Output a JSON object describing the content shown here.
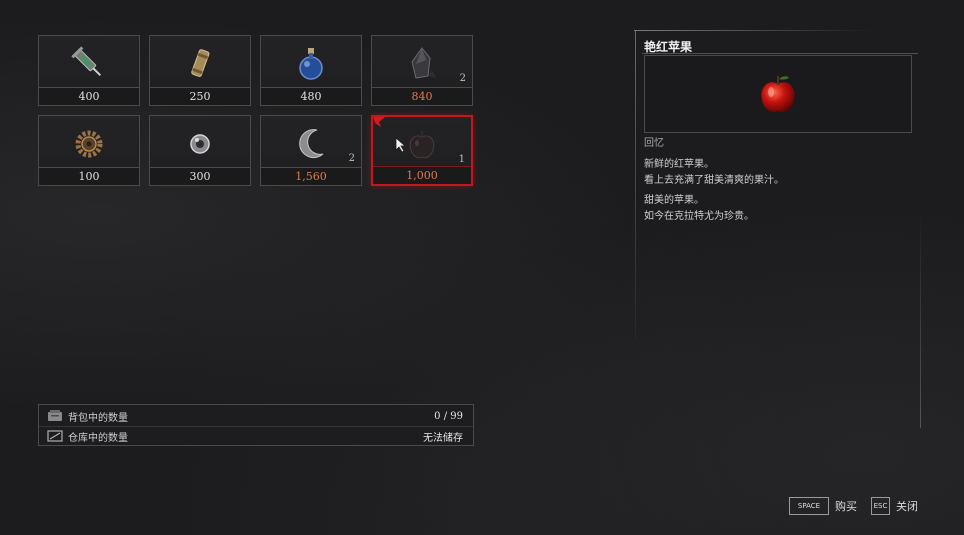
{
  "colors": {
    "selection_border": "#c4161c",
    "expensive_price": "#e07a52",
    "normal_price": "#e2e2e2"
  },
  "items": [
    {
      "icon": "syringe-icon",
      "price": "400",
      "qty": "",
      "expensive": false
    },
    {
      "icon": "cartridge-icon",
      "price": "250",
      "qty": "",
      "expensive": false
    },
    {
      "icon": "potion-flask-icon",
      "price": "480",
      "qty": "",
      "expensive": false
    },
    {
      "icon": "dark-crystal-icon",
      "price": "840",
      "qty": "2",
      "expensive": true
    },
    {
      "icon": "gear-cog-icon",
      "price": "100",
      "qty": "",
      "expensive": false
    },
    {
      "icon": "silver-orb-icon",
      "price": "300",
      "qty": "",
      "expensive": false
    },
    {
      "icon": "moon-shard-icon",
      "price": "1,560",
      "qty": "2",
      "expensive": true
    },
    {
      "icon": "apple-icon",
      "price": "1,000",
      "qty": "1",
      "expensive": true
    }
  ],
  "selected_index": 7,
  "stock": {
    "bag_label": "背包中的数量",
    "bag_value": "0 / 99",
    "storage_label": "仓库中的数量",
    "storage_value": "无法储存"
  },
  "detail": {
    "title": "艳红苹果",
    "category": "回忆",
    "desc1_line1": "新鲜的红苹果。",
    "desc1_line2": "看上去充满了甜美清爽的果汁。",
    "desc2_line1": "甜美的苹果。",
    "desc2_line2": "如今在克拉特尤为珍贵。"
  },
  "hints": {
    "buy_key": "SPACE",
    "buy_label": "购买",
    "close_key": "ESC",
    "close_label": "关闭"
  }
}
